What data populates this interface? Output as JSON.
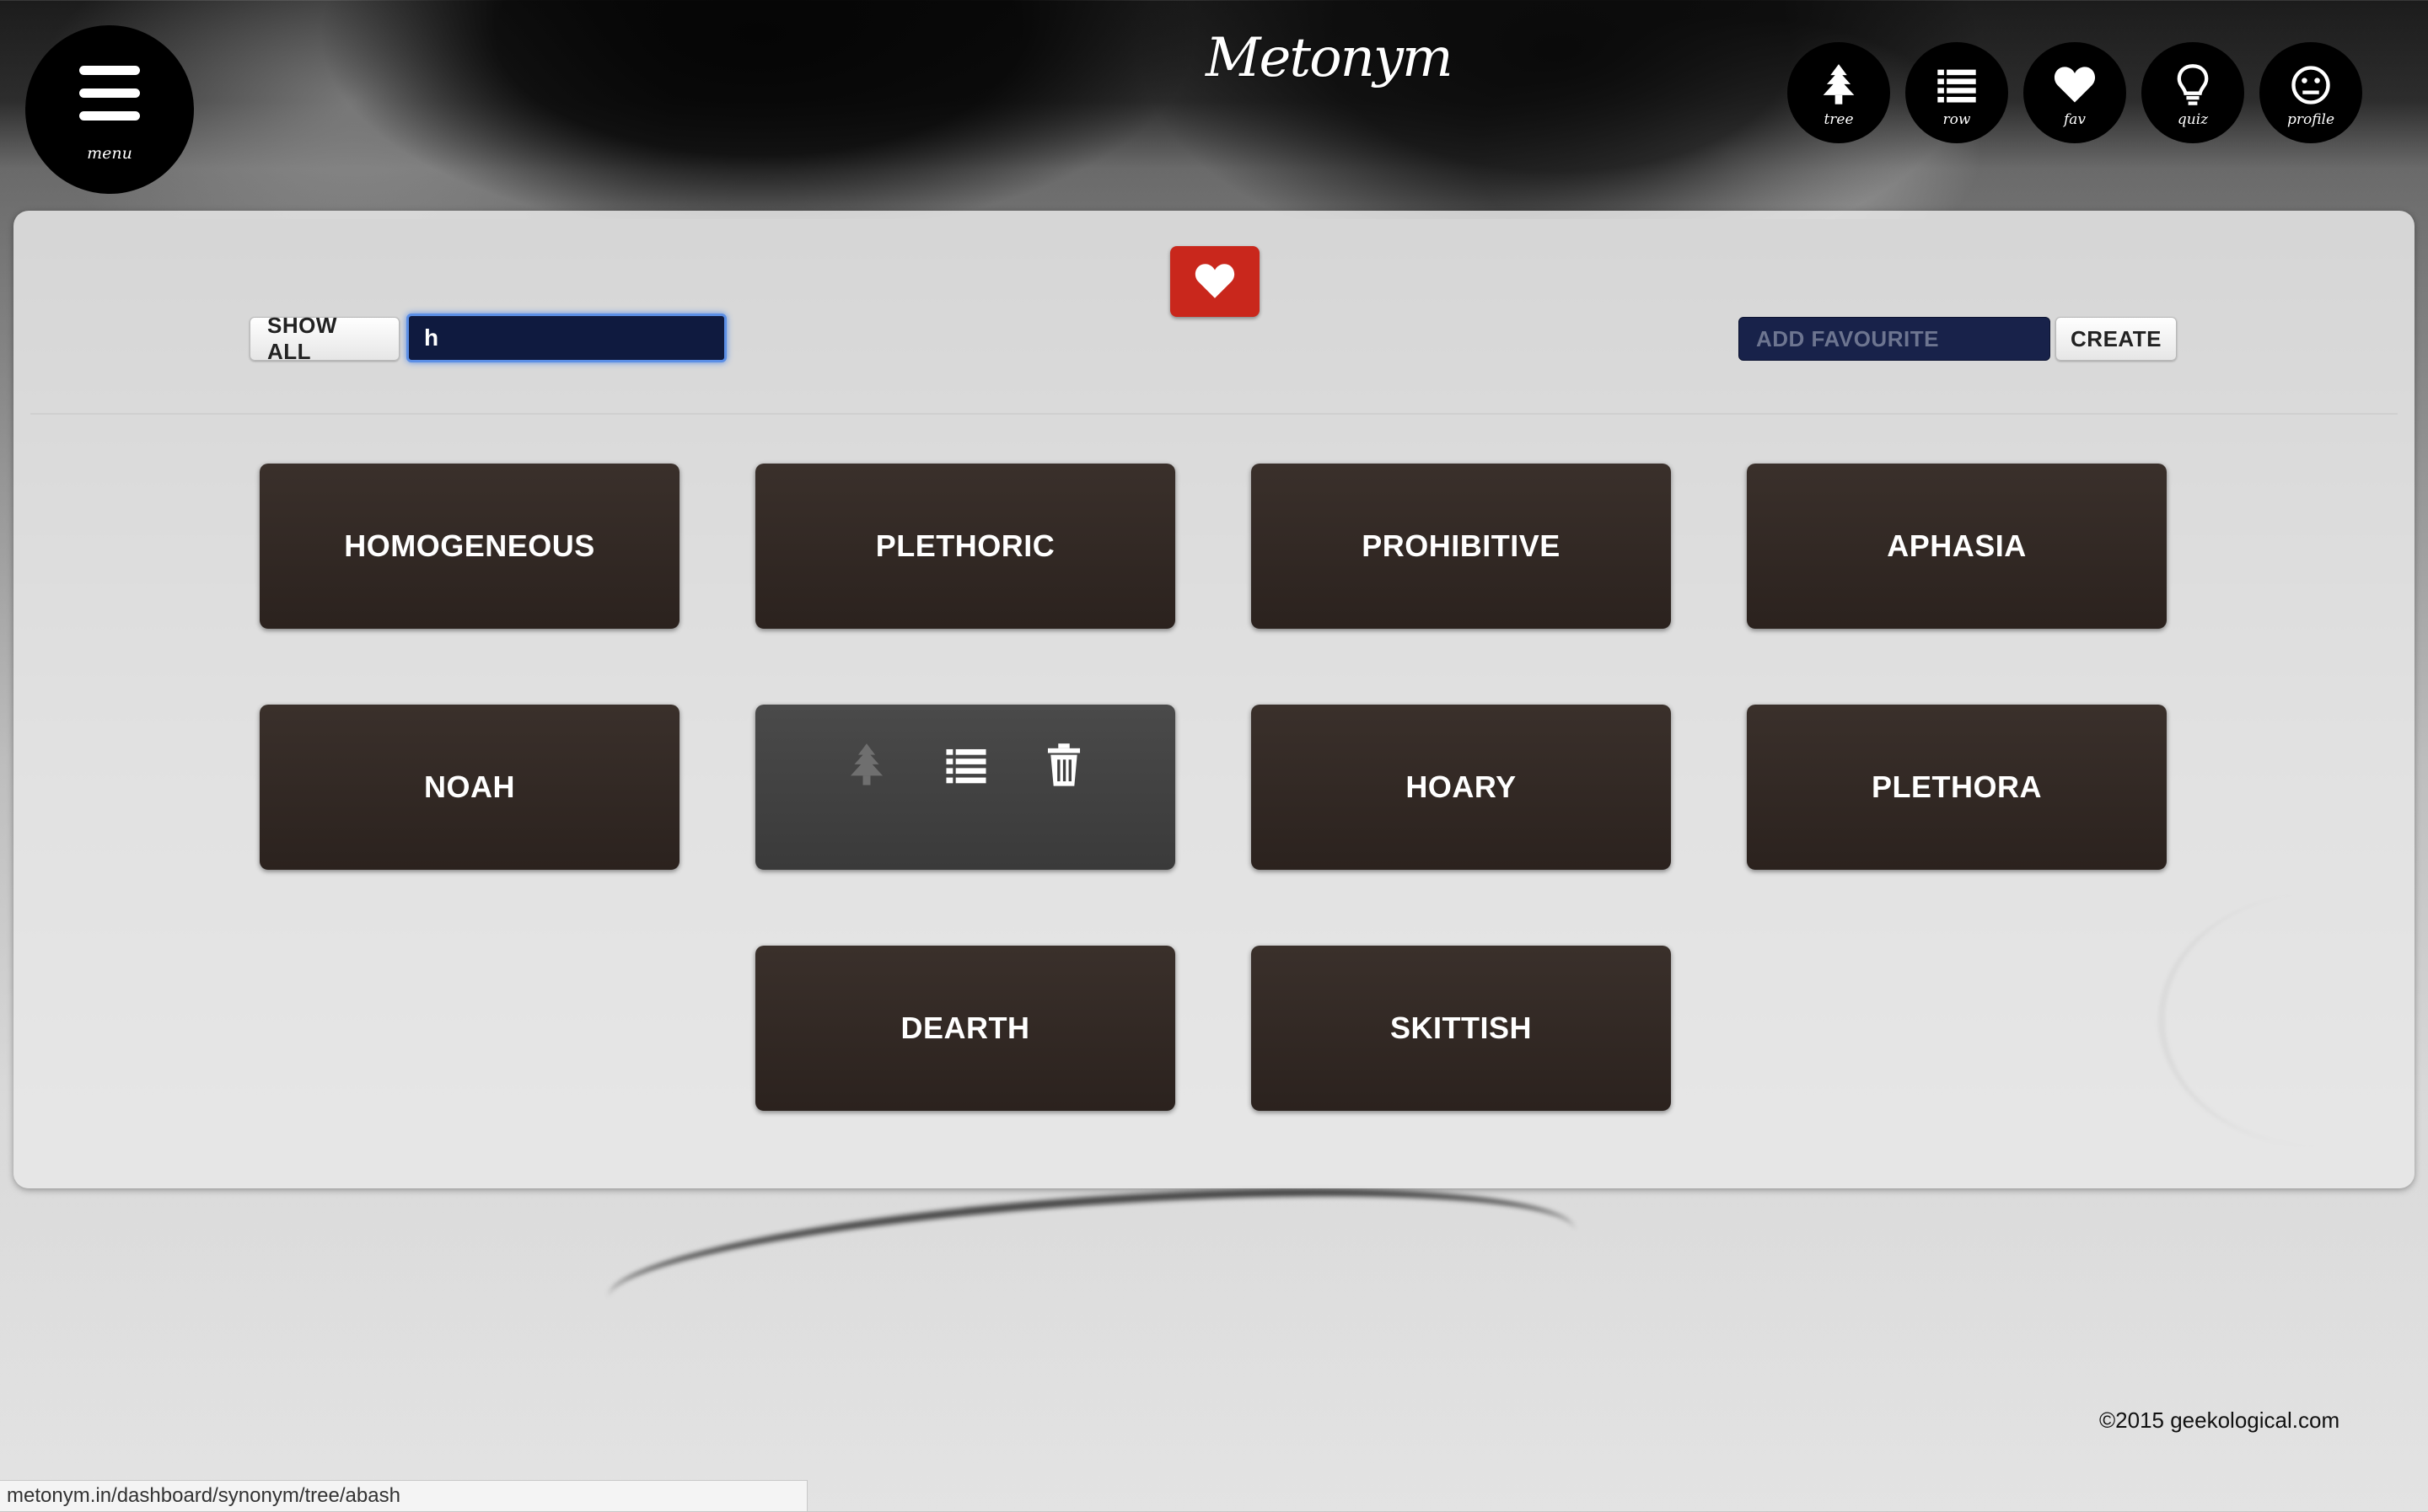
{
  "header": {
    "menu_label": "menu",
    "logo": "Metonym",
    "nav": [
      {
        "label": "tree",
        "icon": "tree-icon"
      },
      {
        "label": "row",
        "icon": "list-icon"
      },
      {
        "label": "fav",
        "icon": "heart-icon"
      },
      {
        "label": "quiz",
        "icon": "lightbulb-icon"
      },
      {
        "label": "profile",
        "icon": "face-icon"
      }
    ]
  },
  "toolbar": {
    "show_all_label": "SHOW ALL",
    "search_value": "h",
    "add_favourite_placeholder": "ADD FAVOURITE",
    "create_label": "CREATE"
  },
  "words": [
    "HOMOGENEOUS",
    "PLETHORIC",
    "PROHIBITIVE",
    "APHASIA",
    "NOAH",
    "",
    "HOARY",
    "PLETHORA",
    "DEARTH",
    "SKITTISH"
  ],
  "footer": {
    "copyright": "©2015 geekological.com",
    "status_url": "metonym.in/dashboard/synonym/tree/abash"
  },
  "colors": {
    "fav_badge": "#c9271c",
    "card": "#2b221e",
    "search_bg": "#0f1a3f"
  }
}
